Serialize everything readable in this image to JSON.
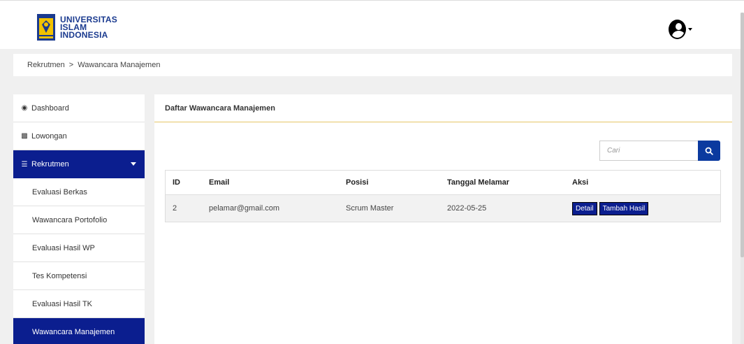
{
  "brand": {
    "line1": "UNIVERSITAS",
    "line2": "ISLAM",
    "line3": "INDONESIA",
    "color": "#1a3a8f"
  },
  "breadcrumb": {
    "parent": "Rekrutmen",
    "separator": ">",
    "current": "Wawancara Manajemen"
  },
  "sidebar": {
    "items": [
      {
        "label": "Dashboard",
        "icon": "dashboard-icon"
      },
      {
        "label": "Lowongan",
        "icon": "briefcase-icon"
      },
      {
        "label": "Rekrutmen",
        "icon": "list-icon"
      }
    ],
    "submenu": [
      {
        "label": "Evaluasi Berkas"
      },
      {
        "label": "Wawancara Portofolio"
      },
      {
        "label": "Evaluasi Hasil WP"
      },
      {
        "label": "Tes Kompetensi"
      },
      {
        "label": "Evaluasi Hasil TK"
      },
      {
        "label": "Wawancara Manajemen"
      }
    ],
    "active_color": "#0b1e8f"
  },
  "panel": {
    "title": "Daftar Wawancara Manajemen",
    "search_placeholder": "Cari",
    "columns": [
      "ID",
      "Email",
      "Posisi",
      "Tanggal Melamar",
      "Aksi"
    ],
    "rows": [
      {
        "id": "2",
        "email": "pelamar@gmail.com",
        "posisi": "Scrum Master",
        "tanggal": "2022-05-25",
        "actions": [
          "Detail",
          "Tambah Hasil"
        ]
      }
    ]
  }
}
